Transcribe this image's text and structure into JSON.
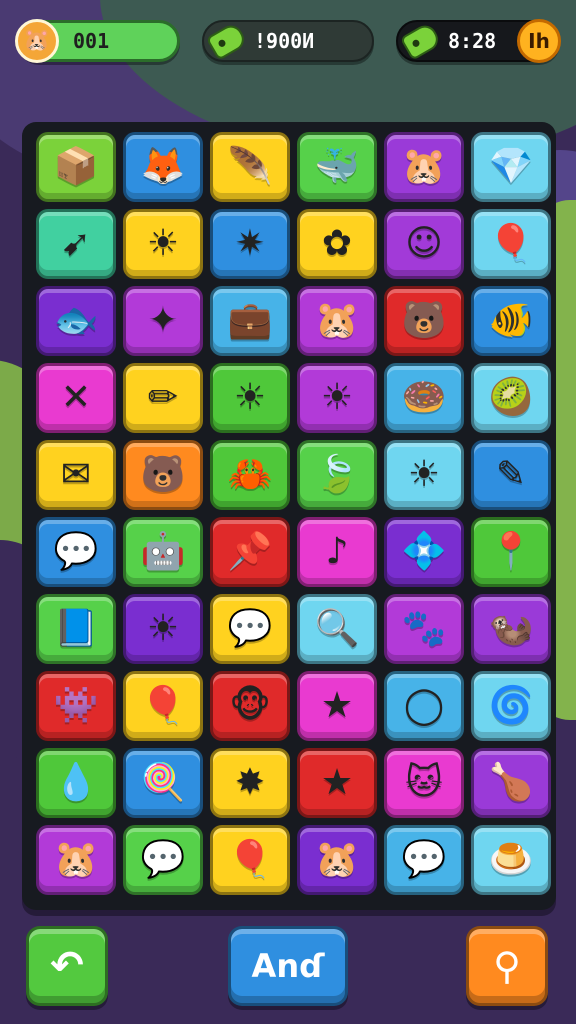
{
  "hud": {
    "level_label": "001",
    "coins_label": "!900Ͷ",
    "timer_label": "8:28",
    "timer_button_label": "Ih",
    "avatar_icon": "hamster-face-icon",
    "coin_icon": "tag-icon"
  },
  "board": {
    "tiles": [
      {
        "name": "box-icon",
        "glyph": "📦",
        "color": "#7bd23a"
      },
      {
        "name": "fox-icon",
        "glyph": "🦊",
        "color": "#2f8fe0"
      },
      {
        "name": "feather-ball-icon",
        "glyph": "🪶",
        "color": "#ffd21f"
      },
      {
        "name": "whale-icon",
        "glyph": "🐳",
        "color": "#56d14a"
      },
      {
        "name": "hamster-icon",
        "glyph": "🐹",
        "color": "#9a3ad8"
      },
      {
        "name": "gem-creature-icon",
        "glyph": "💎",
        "color": "#6fd6f0"
      },
      {
        "name": "arrow-icon",
        "glyph": "➹",
        "color": "#41d0a0"
      },
      {
        "name": "sun-icon",
        "glyph": "☀",
        "color": "#ffd21f"
      },
      {
        "name": "star-badge-icon",
        "glyph": "✷",
        "color": "#2f8fe0"
      },
      {
        "name": "flower-icon",
        "glyph": "✿",
        "color": "#ffd21f"
      },
      {
        "name": "smile-cup-icon",
        "glyph": "☺",
        "color": "#a23ad8"
      },
      {
        "name": "balloon-icon",
        "glyph": "🎈",
        "color": "#6fd6f0"
      },
      {
        "name": "fish-icon",
        "glyph": "🐟",
        "color": "#7a2ed0"
      },
      {
        "name": "wand-icon",
        "glyph": "✦",
        "color": "#b23ad8"
      },
      {
        "name": "suitcase-icon",
        "glyph": "💼",
        "color": "#47b3e8"
      },
      {
        "name": "hamster-icon",
        "glyph": "🐹",
        "color": "#b23ad8"
      },
      {
        "name": "bear-icon",
        "glyph": "🐻",
        "color": "#e02a2a"
      },
      {
        "name": "fish-icon",
        "glyph": "🐠",
        "color": "#2f8fe0"
      },
      {
        "name": "cross-icon",
        "glyph": "✕",
        "color": "#e93ad0"
      },
      {
        "name": "crayon-icon",
        "glyph": "✏",
        "color": "#ffd21f"
      },
      {
        "name": "sun-face-icon",
        "glyph": "☀",
        "color": "#4fc83a"
      },
      {
        "name": "sun-face-icon",
        "glyph": "☀",
        "color": "#b23ad8"
      },
      {
        "name": "donut-icon",
        "glyph": "🍩",
        "color": "#47b3e8"
      },
      {
        "name": "kiwi-icon",
        "glyph": "🥝",
        "color": "#6fd6f0"
      },
      {
        "name": "envelope-icon",
        "glyph": "✉",
        "color": "#ffd21f"
      },
      {
        "name": "bear-icon",
        "glyph": "🐻",
        "color": "#ff8a1f"
      },
      {
        "name": "crab-icon",
        "glyph": "🦀",
        "color": "#4fc83a"
      },
      {
        "name": "leaf-icon",
        "glyph": "🍃",
        "color": "#56d14a"
      },
      {
        "name": "sun-face-icon",
        "glyph": "☀",
        "color": "#6fd6f0"
      },
      {
        "name": "pencil-icon",
        "glyph": "✎",
        "color": "#2f8fe0"
      },
      {
        "name": "chat-bubble-icon",
        "glyph": "💬",
        "color": "#2f8fe0"
      },
      {
        "name": "robot-face-icon",
        "glyph": "🤖",
        "color": "#56d14a"
      },
      {
        "name": "pin-icon",
        "glyph": "📌",
        "color": "#e02a2a"
      },
      {
        "name": "boot-icon",
        "glyph": "♪",
        "color": "#e93ad0"
      },
      {
        "name": "crystal-icon",
        "glyph": "💠",
        "color": "#7a2ed0"
      },
      {
        "name": "pushpin-icon",
        "glyph": "📍",
        "color": "#4fc83a"
      },
      {
        "name": "book-icon",
        "glyph": "📘",
        "color": "#56d14a"
      },
      {
        "name": "sun-icon",
        "glyph": "☀",
        "color": "#7a2ed0"
      },
      {
        "name": "speech-bubble-icon",
        "glyph": "💬",
        "color": "#ffd21f"
      },
      {
        "name": "magnifier-icon",
        "glyph": "🔍",
        "color": "#6fd6f0"
      },
      {
        "name": "paw-icon",
        "glyph": "🐾",
        "color": "#b23ad8"
      },
      {
        "name": "otter-icon",
        "glyph": "🦦",
        "color": "#9a3ad8"
      },
      {
        "name": "alien-icon",
        "glyph": "👾",
        "color": "#e02a2a"
      },
      {
        "name": "balloon-face-icon",
        "glyph": "🎈",
        "color": "#ffd21f"
      },
      {
        "name": "monkey-face-icon",
        "glyph": "🐵",
        "color": "#e02a2a"
      },
      {
        "name": "star-icon",
        "glyph": "★",
        "color": "#e93ad0"
      },
      {
        "name": "ring-icon",
        "glyph": "◯",
        "color": "#47b3e8"
      },
      {
        "name": "swirl-icon",
        "glyph": "🌀",
        "color": "#6fd6f0"
      },
      {
        "name": "water-drop-icon",
        "glyph": "💧",
        "color": "#4fc83a"
      },
      {
        "name": "lollipop-icon",
        "glyph": "🍭",
        "color": "#2f8fe0"
      },
      {
        "name": "burst-icon",
        "glyph": "✸",
        "color": "#ffd21f"
      },
      {
        "name": "star-icon",
        "glyph": "★",
        "color": "#e02a2a"
      },
      {
        "name": "cat-face-icon",
        "glyph": "🐱",
        "color": "#e93ad0"
      },
      {
        "name": "drumstick-icon",
        "glyph": "🍗",
        "color": "#9a3ad8"
      },
      {
        "name": "hamster-icon",
        "glyph": "🐹",
        "color": "#b23ad8"
      },
      {
        "name": "chat-bubble-icon",
        "glyph": "💬",
        "color": "#56d14a"
      },
      {
        "name": "heart-balloon-icon",
        "glyph": "🎈",
        "color": "#ffd21f"
      },
      {
        "name": "hamster-icon",
        "glyph": "🐹",
        "color": "#7a2ed0"
      },
      {
        "name": "bubble-icon",
        "glyph": "💬",
        "color": "#47b3e8"
      },
      {
        "name": "pudding-icon",
        "glyph": "🍮",
        "color": "#6fd6f0"
      }
    ]
  },
  "controls": {
    "back_icon": "back-arrow-icon",
    "back_glyph": "↶",
    "action_label": "Anɗ",
    "hint_icon": "hint-icon",
    "hint_glyph": "⚲"
  }
}
